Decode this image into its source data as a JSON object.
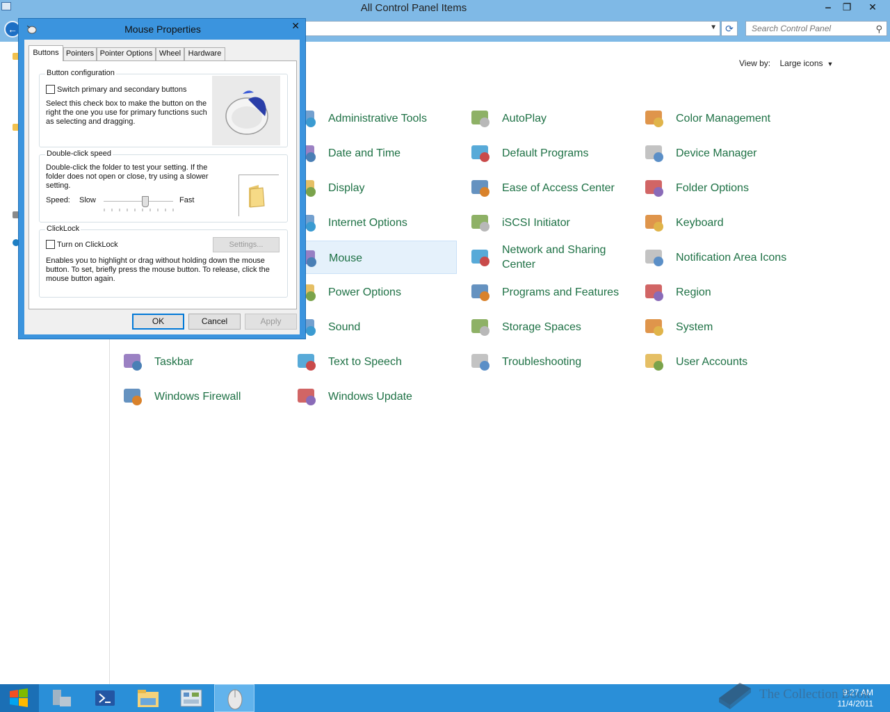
{
  "window": {
    "title": "All Control Panel Items",
    "minimize": "‒",
    "maximize": "❐",
    "close": "✕"
  },
  "toolbar": {
    "search_placeholder": "Search Control Panel",
    "refresh": "⟳",
    "back": "←"
  },
  "view": {
    "label": "View by:",
    "value": "Large icons"
  },
  "items": [
    {
      "label": "Administrative Tools",
      "icon": "admin-tools-icon"
    },
    {
      "label": "AutoPlay",
      "icon": "autoplay-icon"
    },
    {
      "label": "Color Management",
      "icon": "color-management-icon"
    },
    {
      "label": "Date and Time",
      "icon": "date-time-icon"
    },
    {
      "label": "Default Programs",
      "icon": "default-programs-icon"
    },
    {
      "label": "Device Manager",
      "icon": "device-manager-icon"
    },
    {
      "label": "Display",
      "icon": "display-icon"
    },
    {
      "label": "Ease of Access Center",
      "icon": "ease-of-access-icon"
    },
    {
      "label": "Folder Options",
      "icon": "folder-options-icon"
    },
    {
      "label": "Internet Options",
      "icon": "internet-options-icon"
    },
    {
      "label": "iSCSI Initiator",
      "icon": "iscsi-icon"
    },
    {
      "label": "Keyboard",
      "icon": "keyboard-icon"
    },
    {
      "label": "Mouse",
      "icon": "mouse-icon"
    },
    {
      "label": "Network and Sharing Center",
      "icon": "network-icon"
    },
    {
      "label": "Notification Area Icons",
      "icon": "notification-icon"
    },
    {
      "label": "Power Options",
      "icon": "power-icon"
    },
    {
      "label": "Programs and Features",
      "icon": "programs-icon"
    },
    {
      "label": "Region",
      "icon": "region-icon"
    },
    {
      "label": "Sound",
      "icon": "sound-icon"
    },
    {
      "label": "Storage Spaces",
      "icon": "storage-icon"
    },
    {
      "label": "System",
      "icon": "system-icon"
    },
    {
      "label": "Taskbar",
      "icon": "taskbar-icon"
    },
    {
      "label": "Text to Speech",
      "icon": "speech-icon"
    },
    {
      "label": "Troubleshooting",
      "icon": "troubleshooting-icon"
    },
    {
      "label": "User Accounts",
      "icon": "user-accounts-icon"
    },
    {
      "label": "Windows Firewall",
      "icon": "firewall-icon"
    },
    {
      "label": "Windows Update",
      "icon": "windows-update-icon"
    }
  ],
  "dialog": {
    "title": "Mouse Properties",
    "close": "✕",
    "tabs": [
      "Buttons",
      "Pointers",
      "Pointer Options",
      "Wheel",
      "Hardware"
    ],
    "active_tab": "Buttons",
    "button_config": {
      "title": "Button configuration",
      "checkbox_label": "Switch primary and secondary buttons",
      "checked": false,
      "description": "Select this check box to make the button on the right the one you use for primary functions such as selecting and dragging."
    },
    "double_click": {
      "title": "Double-click speed",
      "description": "Double-click the folder to test your setting. If the folder does not open or close, try using a slower setting.",
      "speed_label": "Speed:",
      "slow": "Slow",
      "fast": "Fast",
      "speed_level": 0.6
    },
    "clicklock": {
      "title": "ClickLock",
      "checkbox_label": "Turn on ClickLock",
      "checked": false,
      "settings_button": "Settings...",
      "description": "Enables you to highlight or drag without holding down the mouse button. To set, briefly press the mouse button. To release, click the mouse button again."
    },
    "ok": "OK",
    "cancel": "Cancel",
    "apply": "Apply"
  },
  "taskbar": {
    "time": "9:27 AM",
    "date": "11/4/2011"
  },
  "watermark": "The Collection Book",
  "colors": {
    "titlebar": "#7fb9e6",
    "link_green": "#1e7145",
    "dialog_frame": "#3b94de",
    "taskbar": "#2a8fd8"
  }
}
